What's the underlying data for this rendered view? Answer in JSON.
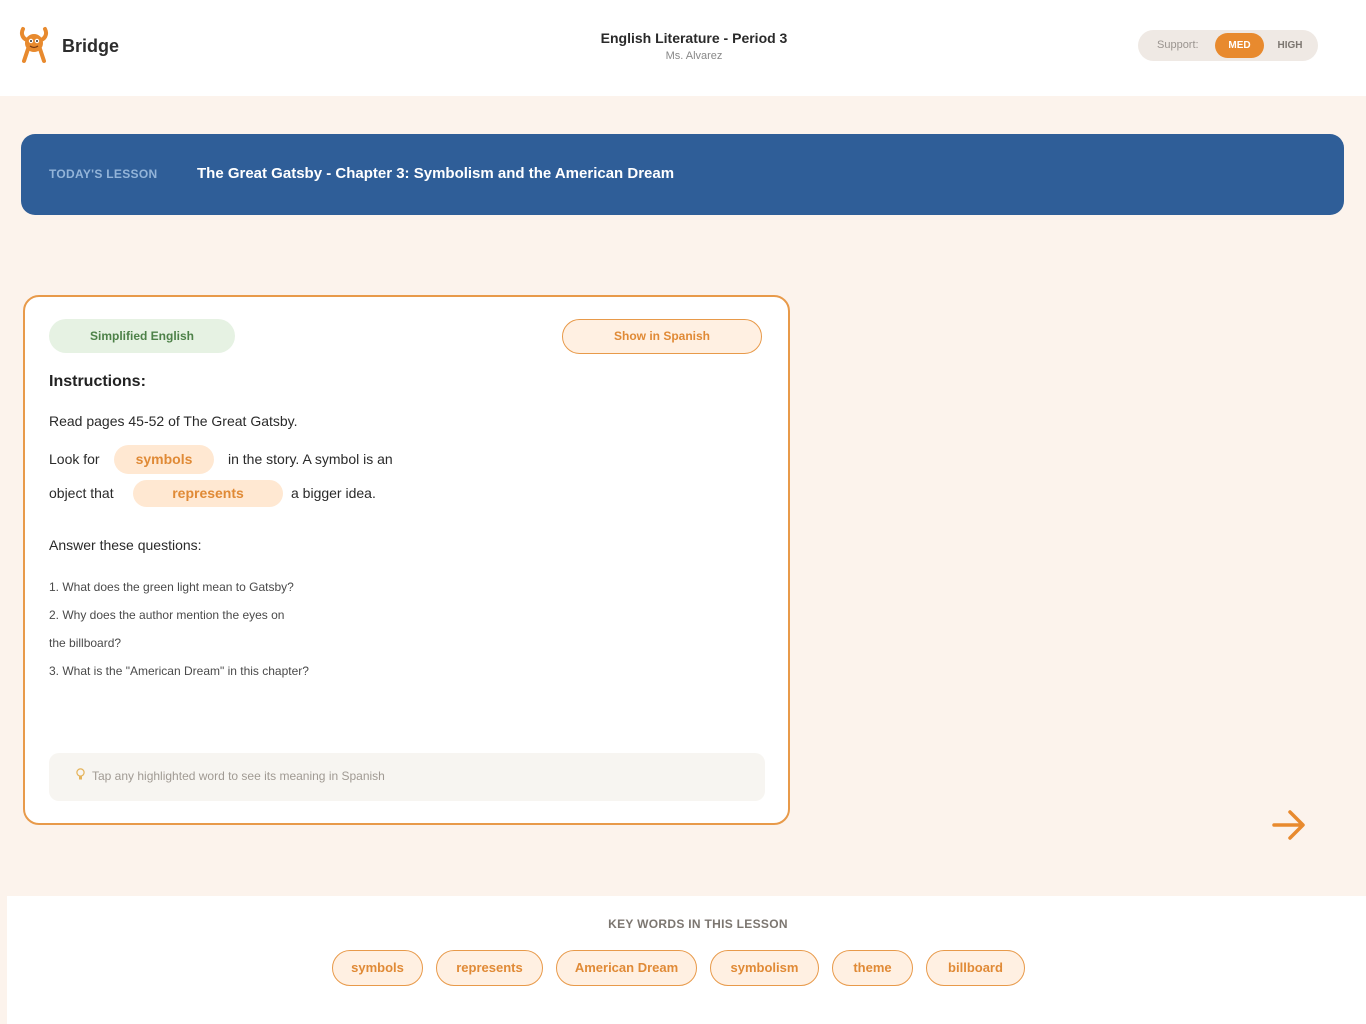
{
  "header": {
    "brand": "Bridge",
    "class_title": "English Literature - Period 3",
    "teacher": "Ms. Alvarez",
    "support": {
      "label": "Support:",
      "options": [
        "MED",
        "HIGH"
      ],
      "selected": "MED"
    }
  },
  "banner": {
    "label": "TODAY'S LESSON",
    "title": "The Great Gatsby - Chapter 3: Symbolism and the American Dream"
  },
  "card": {
    "mode_badge": "Simplified English",
    "show_spanish_label": "Show in Spanish",
    "instructions_heading": "Instructions:",
    "line1": "Read pages 45-52 of The Great Gatsby.",
    "line2_before": "Look for",
    "line2_word": "symbols",
    "line2_after": "in the story. A symbol is an",
    "line3_before": "object that",
    "line3_word": "represents",
    "line3_after": "a bigger idea.",
    "answer_heading": "Answer these questions:",
    "questions": [
      "1. What does the green light mean to Gatsby?",
      "2. Why does the author mention the eyes on",
      "the billboard?",
      "3. What is the \"American Dream\" in this chapter?"
    ],
    "tip_icon": "lightbulb-icon",
    "tip": "Tap any highlighted word to see its meaning in Spanish"
  },
  "next_icon": "arrow-right-icon",
  "keywords": {
    "title": "KEY WORDS IN THIS LESSON",
    "items": [
      "symbols",
      "represents",
      "American Dream",
      "symbolism",
      "theme",
      "billboard"
    ]
  },
  "colors": {
    "accent": "#e88a2e",
    "banner": "#2f5e98",
    "background": "#fcf3ec",
    "badge_green": "#e6f2e3"
  }
}
